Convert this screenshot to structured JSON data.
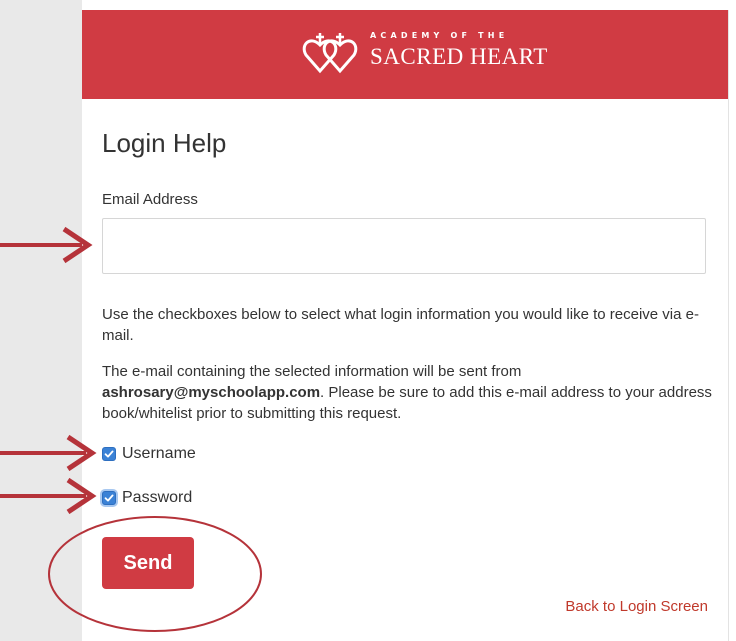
{
  "header": {
    "logo_top": "ACADEMY OF THE",
    "logo_bottom": "SACRED HEART"
  },
  "form": {
    "title": "Login Help",
    "email_label": "Email Address",
    "email_value": "",
    "instructions": "Use the checkboxes below to select what login information you would like to receive via e-mail.",
    "notice_before": "The e-mail containing the selected information will be sent from ",
    "notice_email": "ashrosary@myschoolapp.com",
    "notice_after": ". Please be sure to add this e-mail address to your address book/whitelist prior to submitting this request.",
    "options": [
      {
        "label": "Username",
        "checked": true
      },
      {
        "label": "Password",
        "checked": true
      }
    ],
    "send_label": "Send",
    "back_link": "Back to Login Screen"
  },
  "colors": {
    "brand_red": "#d03b43",
    "annotation_red": "#b5333a",
    "checkbox_blue": "#3b82d6"
  },
  "icons": [
    "sacred-heart-logo-icon",
    "check-icon",
    "annotation-arrow",
    "annotation-circle"
  ]
}
